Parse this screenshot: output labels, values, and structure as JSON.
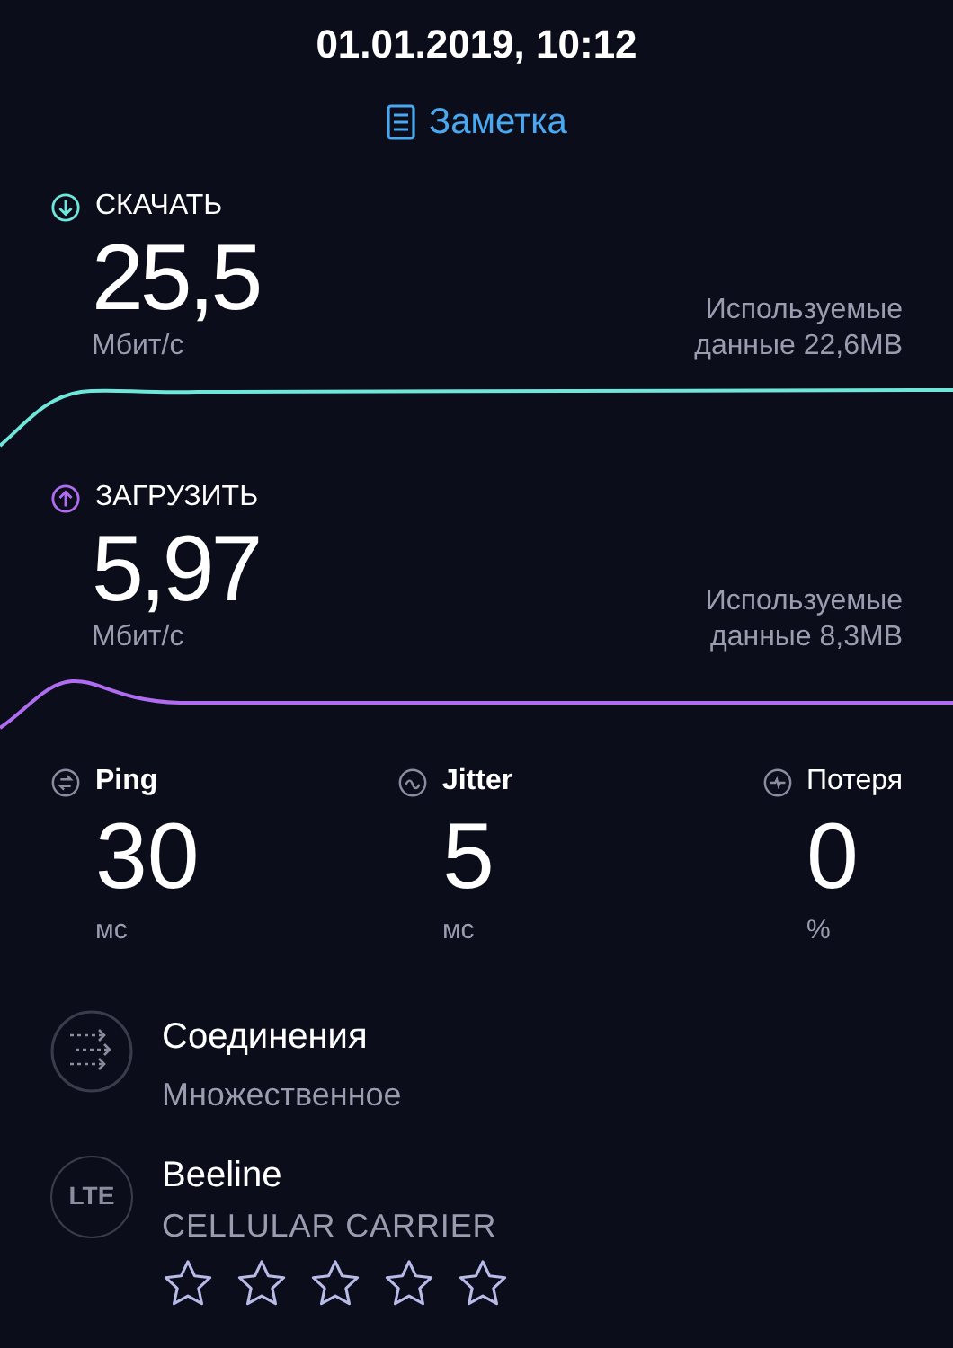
{
  "header": {
    "datetime": "01.01.2019, 10:12",
    "note_link": "Заметка"
  },
  "speeds": [
    {
      "kind": "download",
      "label": "СКАЧАТЬ",
      "value": "25,5",
      "unit": "Мбит/с",
      "data_used": "Используемые данные 22,6MB",
      "color": "#6ee6d9"
    },
    {
      "kind": "upload",
      "label": "ЗАГРУЗИТЬ",
      "value": "5,97",
      "unit": "Мбит/с",
      "data_used": "Используемые данные 8,3MB",
      "color": "#b06cf0"
    }
  ],
  "metrics": [
    {
      "kind": "ping",
      "label": "Ping",
      "value": "30",
      "unit": "мс"
    },
    {
      "kind": "jitter",
      "label": "Jitter",
      "value": "5",
      "unit": "мс"
    },
    {
      "kind": "loss",
      "label": "Потеря",
      "value": "0",
      "unit": "%"
    }
  ],
  "connections": {
    "title": "Соединения",
    "subtitle": "Множественное"
  },
  "provider": {
    "badge": "LTE",
    "name": "Beeline",
    "subtitle": "CELLULAR CARRIER",
    "stars": 0
  }
}
